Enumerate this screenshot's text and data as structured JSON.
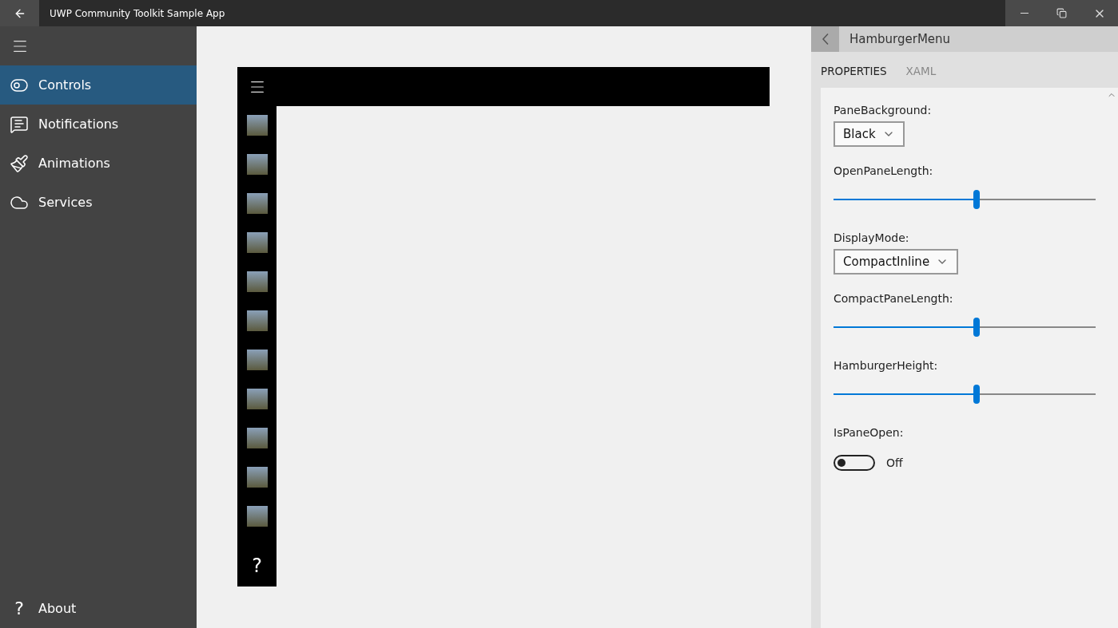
{
  "window": {
    "title": "UWP Community Toolkit Sample App"
  },
  "nav": {
    "items": [
      {
        "label": "Controls",
        "selected": true
      },
      {
        "label": "Notifications",
        "selected": false
      },
      {
        "label": "Animations",
        "selected": false
      },
      {
        "label": "Services",
        "selected": false
      }
    ],
    "footer": {
      "glyph": "?",
      "label": "About",
      "selected": false
    }
  },
  "sample": {
    "pane_items": [
      {
        "kind": "photo"
      },
      {
        "kind": "photo"
      },
      {
        "kind": "photo"
      },
      {
        "kind": "photo"
      },
      {
        "kind": "photo"
      },
      {
        "kind": "photo"
      },
      {
        "kind": "photo"
      },
      {
        "kind": "photo"
      },
      {
        "kind": "photo"
      },
      {
        "kind": "photo"
      },
      {
        "kind": "photo"
      }
    ],
    "footer_glyph": "?"
  },
  "panel": {
    "title": "HamburgerMenu",
    "tabs": [
      {
        "label": "PROPERTIES",
        "selected": true
      },
      {
        "label": "XAML",
        "selected": false
      }
    ],
    "properties": [
      {
        "kind": "dropdown",
        "label": "PaneBackground:",
        "value": "Black"
      },
      {
        "kind": "slider",
        "label": "OpenPaneLength:",
        "level": 0.545
      },
      {
        "kind": "dropdown",
        "label": "DisplayMode:",
        "value": "CompactInline"
      },
      {
        "kind": "slider",
        "label": "CompactPaneLength:",
        "level": 0.545
      },
      {
        "kind": "slider",
        "label": "HamburgerHeight:",
        "level": 0.545
      },
      {
        "kind": "toggle",
        "label": "IsPaneOpen:",
        "on": false,
        "state_text": "Off"
      }
    ]
  }
}
